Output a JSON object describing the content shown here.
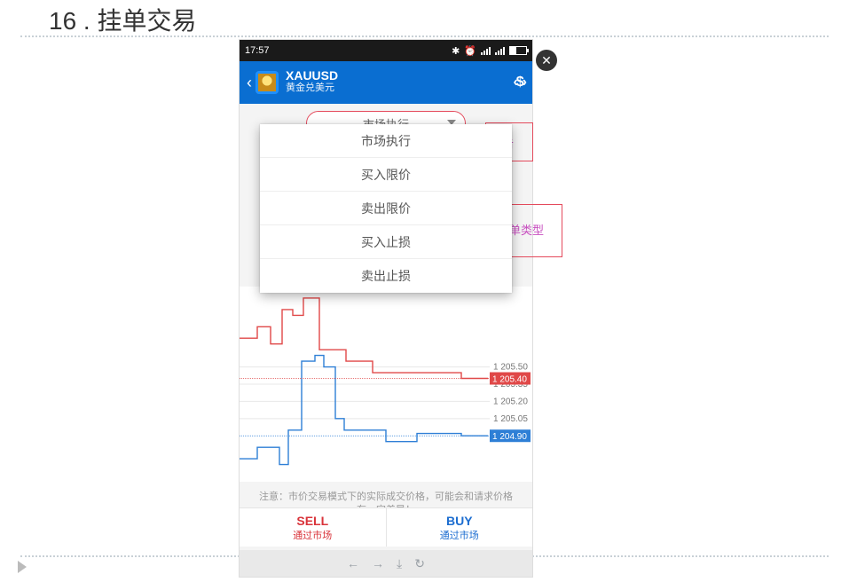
{
  "page_heading": "16 . 挂单交易",
  "status": {
    "time": "17:57",
    "icons": {
      "bt": "bluetooth-icon",
      "alarm": "alarm-icon"
    }
  },
  "header": {
    "symbol": "XAUUSD",
    "subtitle": "黄金兑美元",
    "swap_glyph": "‹$›"
  },
  "selector": {
    "label": "市场执行"
  },
  "dropdown": {
    "items": [
      "市场执行",
      "买入限价",
      "卖出限价",
      "买入止损",
      "卖出止损"
    ]
  },
  "chart_data": {
    "type": "line",
    "y_ticks": [
      1205.5,
      1205.35,
      1205.2,
      1205.05
    ],
    "flags": [
      {
        "value": "1 205.40",
        "color": "#e04848",
        "y": 1205.4
      },
      {
        "value": "1 204.90",
        "color": "#2e7fd6",
        "y": 1204.9
      }
    ],
    "series": [
      {
        "name": "ask",
        "color": "#e04848",
        "points": [
          [
            0,
            1205.75
          ],
          [
            20,
            1205.75
          ],
          [
            20,
            1205.85
          ],
          [
            35,
            1205.85
          ],
          [
            35,
            1205.7
          ],
          [
            48,
            1205.7
          ],
          [
            48,
            1206.0
          ],
          [
            60,
            1206.0
          ],
          [
            60,
            1205.95
          ],
          [
            72,
            1205.95
          ],
          [
            72,
            1206.1
          ],
          [
            90,
            1206.1
          ],
          [
            90,
            1205.65
          ],
          [
            120,
            1205.65
          ],
          [
            120,
            1205.55
          ],
          [
            150,
            1205.55
          ],
          [
            150,
            1205.45
          ],
          [
            250,
            1205.45
          ],
          [
            250,
            1205.4
          ],
          [
            280,
            1205.4
          ]
        ]
      },
      {
        "name": "bid",
        "color": "#2e7fd6",
        "points": [
          [
            0,
            1204.7
          ],
          [
            20,
            1204.7
          ],
          [
            20,
            1204.8
          ],
          [
            45,
            1204.8
          ],
          [
            45,
            1204.65
          ],
          [
            55,
            1204.65
          ],
          [
            55,
            1204.95
          ],
          [
            70,
            1204.95
          ],
          [
            70,
            1205.55
          ],
          [
            85,
            1205.55
          ],
          [
            85,
            1205.6
          ],
          [
            95,
            1205.6
          ],
          [
            95,
            1205.5
          ],
          [
            108,
            1205.5
          ],
          [
            108,
            1205.05
          ],
          [
            118,
            1205.05
          ],
          [
            118,
            1204.95
          ],
          [
            165,
            1204.95
          ],
          [
            165,
            1204.85
          ],
          [
            200,
            1204.85
          ],
          [
            200,
            1204.92
          ],
          [
            250,
            1204.92
          ],
          [
            250,
            1204.9
          ],
          [
            280,
            1204.9
          ]
        ]
      }
    ],
    "ylim": [
      1204.5,
      1206.2
    ]
  },
  "note": "注意：市价交易模式下的实际成交价格，可能会和请求价格有一定差异！",
  "buttons": {
    "sell": {
      "l1": "SELL",
      "l2": "通过市场"
    },
    "buy": {
      "l1": "BUY",
      "l2": "通过市场"
    }
  },
  "navbar": [
    "←",
    "→",
    "⤓",
    "↻"
  ],
  "annotations": {
    "click_label": "点击",
    "select_label": "选择挂单类型"
  }
}
